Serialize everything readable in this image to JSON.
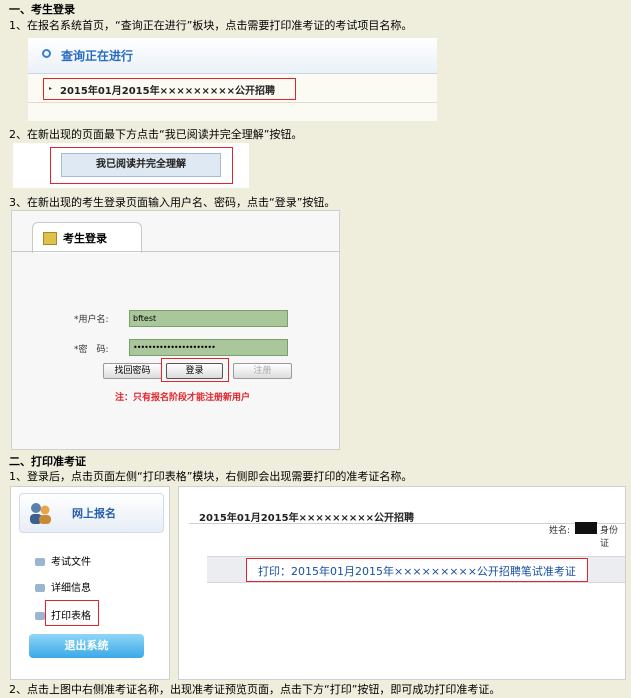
{
  "sections": {
    "s1_title": "一、考生登录",
    "s2_title": "二、打印准考证"
  },
  "steps": {
    "step1": "1、在报名系统首页，“查询正在进行”板块，点击需要打印准考证的考试项目名称。",
    "step2": "2、在新出现的页面最下方点击“我已阅读并完全理解”按钮。",
    "step3": "3、在新出现的考生登录页面输入用户名、密码，点击“登录”按钮。",
    "p2_step1": "1、登录后，点击页面左侧“打印表格”模块，右侧即会出现需要打印的准考证名称。",
    "p2_step2": "2、点击上图中右侧准考证名称，出现准考证预览页面，点击下方“打印”按钮，即可成功打印准考证。"
  },
  "shot1": {
    "panel_title": "查询正在进行",
    "exam_link": "2015年01月2015年×××××××××公开招聘"
  },
  "shot2": {
    "agree_button": "我已阅读并完全理解"
  },
  "shot3": {
    "tab_title": "考生登录",
    "username_label": "*用户名:",
    "username_value": "bftest",
    "password_label": "*密　码:",
    "password_value": "••••••••••••••••••••••",
    "retrieve_button": "找回密码",
    "login_button": "登录",
    "register_button": "注册",
    "note": "注：只有报名阶段才能注册新用户"
  },
  "shot4": {
    "sidebar_title": "网上报名",
    "menu": [
      "考试文件",
      "详细信息",
      "打印表格"
    ],
    "logout_button": "退出系统",
    "exam_title": "2015年01月2015年×××××××××公开招聘",
    "name_label": "姓名:",
    "id_label": "身份证",
    "print_link": "打印：2015年01月2015年×××××××××公开招聘笔试准考证"
  },
  "colors": {
    "page_bg": "#efeedd",
    "highlight_red": "#e0262d",
    "link_blue": "#1a4fa0",
    "note_red": "#e0262d"
  }
}
